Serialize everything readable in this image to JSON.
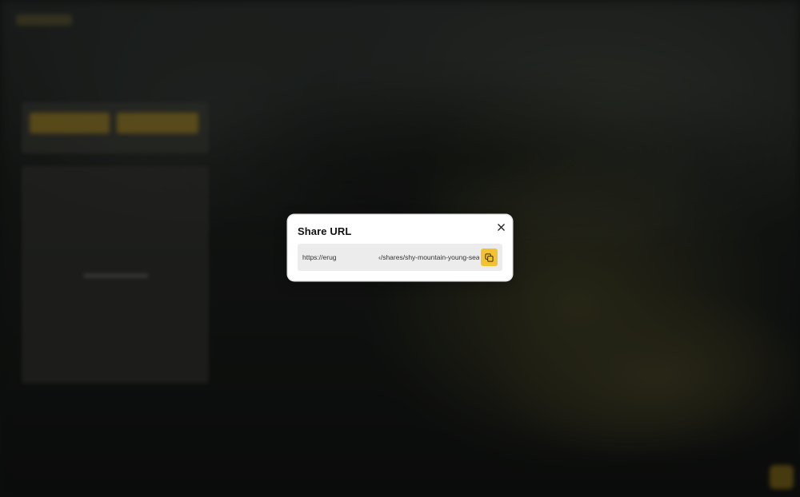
{
  "modal": {
    "title": "Share URL",
    "close_icon": "close-icon",
    "url_start": "https://erug",
    "url_end": "‹/shares/shy-mountain-young-sea",
    "copy_icon": "copy-icon"
  },
  "colors": {
    "accent": "#f2c230",
    "modal_bg": "#ffffff",
    "url_field_bg": "#ececec"
  }
}
